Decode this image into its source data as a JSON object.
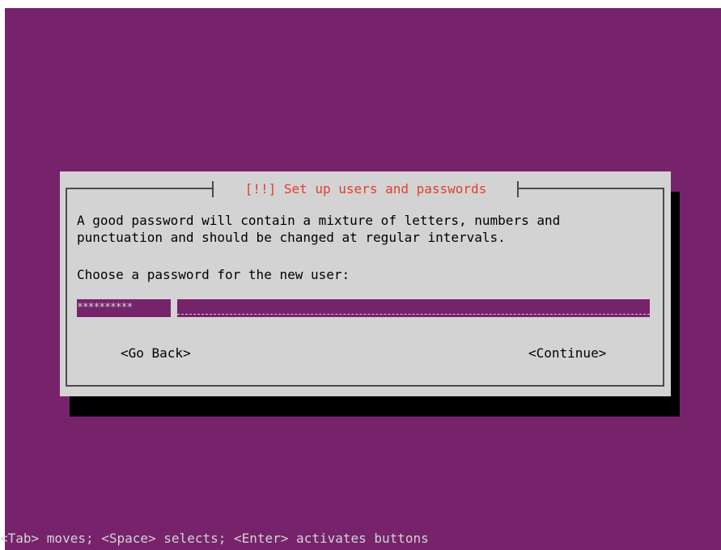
{
  "dialog": {
    "title": "[!!] Set up users and passwords",
    "description_lines": [
      "A good password will contain a mixture of letters, numbers and",
      "punctuation and should be changed at regular intervals."
    ],
    "prompt": "Choose a password for the new user:",
    "password_mask": "**********",
    "buttons": {
      "back": "<Go Back>",
      "continue": "<Continue>"
    }
  },
  "help_bar": "<Tab> moves; <Space> selects; <Enter> activates buttons",
  "colors": {
    "background": "#76236c",
    "dialog_bg": "#d3d3d3",
    "title": "#e1412c",
    "shadow": "#000000"
  }
}
